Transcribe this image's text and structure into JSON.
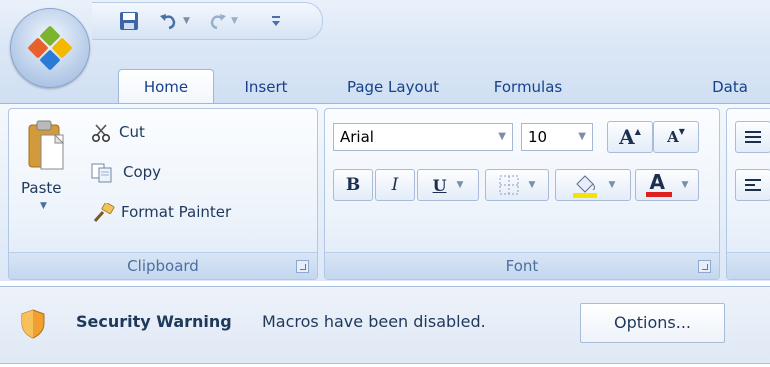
{
  "tabs": [
    "Home",
    "Insert",
    "Page Layout",
    "Formulas",
    "Data"
  ],
  "clipboard": {
    "paste_label": "Paste",
    "cut_label": "Cut",
    "copy_label": "Copy",
    "format_painter_label": "Format Painter",
    "group_label": "Clipboard"
  },
  "font": {
    "font_name": "Arial",
    "font_size": "10",
    "group_label": "Font",
    "bold": "B",
    "italic": "I",
    "underline": "U",
    "font_color_glyph": "A",
    "grow_glyph": "A",
    "shrink_glyph": "A"
  },
  "security_bar": {
    "title": "Security Warning",
    "message": "Macros have been disabled.",
    "options_label": "Options..."
  },
  "icons": [
    "office-button-icon",
    "save-icon",
    "undo-icon",
    "redo-icon",
    "customize-qat-icon",
    "paste-icon",
    "cut-icon",
    "copy-icon",
    "format-painter-icon",
    "borders-icon",
    "fill-color-icon",
    "font-color-icon",
    "align-icon",
    "shield-icon"
  ],
  "colors": {
    "fill_color_bar": "#f5e400",
    "font_color_bar": "#e02020",
    "tab_text": "#15428b"
  }
}
